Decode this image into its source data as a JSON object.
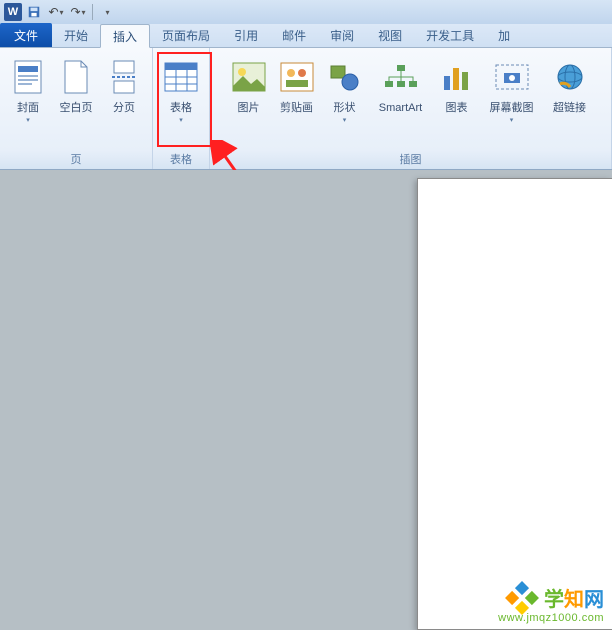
{
  "titlebar": {
    "app_letter": "W"
  },
  "tabs": {
    "file": "文件",
    "items": [
      "开始",
      "插入",
      "页面布局",
      "引用",
      "邮件",
      "审阅",
      "视图",
      "开发工具",
      "加"
    ],
    "active_index": 1
  },
  "ribbon": {
    "groups": {
      "pages": {
        "label": "页",
        "items": [
          "封面",
          "空白页",
          "分页"
        ]
      },
      "tables": {
        "label": "表格",
        "items": [
          "表格"
        ]
      },
      "illustrations": {
        "label": "插图",
        "items": [
          "图片",
          "剪贴画",
          "形状",
          "SmartArt",
          "图表",
          "屏幕截图",
          "超链接"
        ]
      }
    }
  },
  "watermark": {
    "brand": "学知网",
    "url": "www.jmqz1000.com"
  }
}
